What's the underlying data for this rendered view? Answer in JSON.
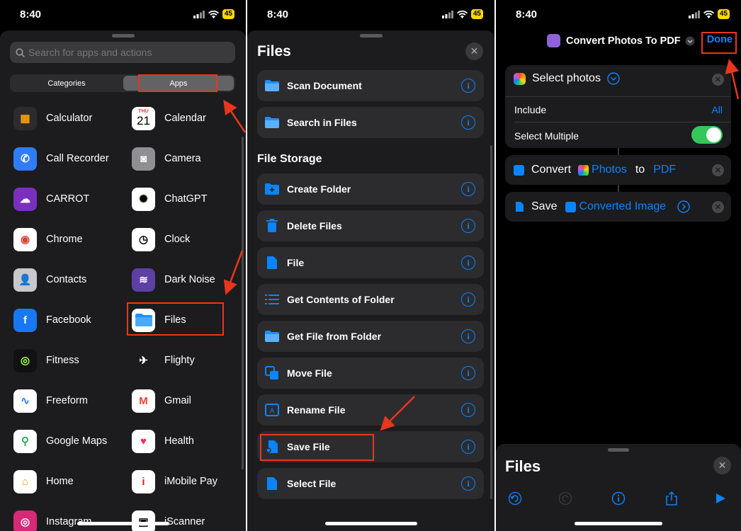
{
  "status": {
    "time": "8:40",
    "battery": "45"
  },
  "panel1": {
    "search_placeholder": "Search for apps and actions",
    "segments": [
      "Categories",
      "Apps"
    ],
    "apps_left": [
      "Calculator",
      "Call Recorder",
      "CARROT",
      "Chrome",
      "Contacts",
      "Facebook",
      "Fitness",
      "Freeform",
      "Google Maps",
      "Home",
      "Instagram"
    ],
    "apps_right": [
      "Calendar",
      "Camera",
      "ChatGPT",
      "Clock",
      "Dark Noise",
      "Files",
      "Flighty",
      "Gmail",
      "Health",
      "iMobile Pay",
      "iScanner"
    ],
    "calendar_day": "THU",
    "calendar_date": "21"
  },
  "panel2": {
    "title": "Files",
    "top_actions": [
      "Scan Document",
      "Search in Files"
    ],
    "section": "File Storage",
    "storage_actions": [
      "Create Folder",
      "Delete Files",
      "File",
      "Get Contents of Folder",
      "Get File from Folder",
      "Move File",
      "Rename File",
      "Save File",
      "Select File"
    ]
  },
  "panel3": {
    "workflow_title": "Convert Photos To PDF",
    "done": "Done",
    "select_photos": "Select photos",
    "include_label": "Include",
    "include_value": "All",
    "select_multiple": "Select Multiple",
    "select_multiple_on": true,
    "convert": "Convert",
    "convert_photos": "Photos",
    "convert_to": "to",
    "convert_pdf": "PDF",
    "save": "Save",
    "save_input": "Converted Image",
    "bottom_title": "Files"
  },
  "colors": {
    "accent": "#0a84ff",
    "annotation": "#e8361f",
    "toggle_on": "#34c759"
  }
}
